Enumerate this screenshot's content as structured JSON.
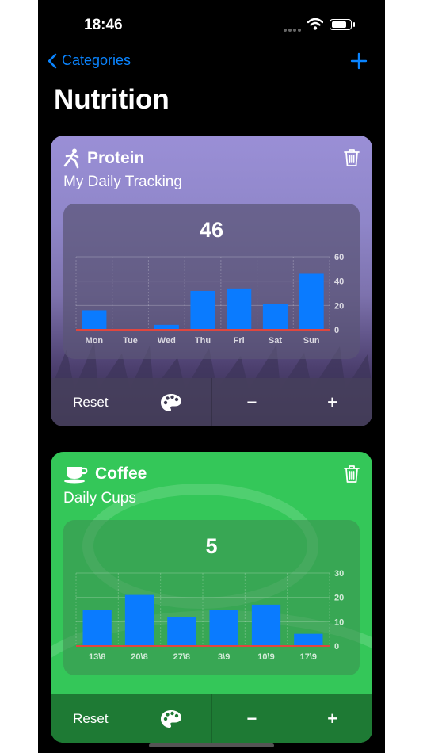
{
  "status_bar": {
    "time": "18:46"
  },
  "nav": {
    "back_label": "Categories",
    "back_icon": "chevron-left-icon",
    "add_icon": "plus-icon"
  },
  "page": {
    "title": "Nutrition"
  },
  "colors": {
    "accent": "#0a84ff",
    "bar": "#0a7bff",
    "baseline": "#e0463f",
    "coffee_card": "#34c759"
  },
  "cards": [
    {
      "name": "Protein",
      "subtitle": "My Daily Tracking",
      "icon": "running-figure-icon",
      "value": "46",
      "buttons": {
        "reset": "Reset",
        "palette_icon": "palette-icon",
        "minus": "−",
        "plus": "+"
      }
    },
    {
      "name": "Coffee",
      "subtitle": "Daily Cups",
      "icon": "coffee-cup-icon",
      "value": "5",
      "buttons": {
        "reset": "Reset",
        "palette_icon": "palette-icon",
        "minus": "−",
        "plus": "+"
      }
    }
  ],
  "chart_data": [
    {
      "type": "bar",
      "categories": [
        "Mon",
        "Tue",
        "Wed",
        "Thu",
        "Fri",
        "Sat",
        "Sun"
      ],
      "values": [
        16,
        0,
        4,
        32,
        34,
        21,
        46
      ],
      "ylim": [
        0,
        60
      ],
      "yticks": [
        0,
        20,
        40,
        60
      ],
      "grid": true,
      "y_axis_position": "right"
    },
    {
      "type": "bar",
      "categories": [
        "13\\8",
        "20\\8",
        "27\\8",
        "3\\9",
        "10\\9",
        "17\\9"
      ],
      "values": [
        15,
        21,
        12,
        15,
        17,
        5
      ],
      "ylim": [
        0,
        30
      ],
      "yticks": [
        0,
        10,
        20,
        30
      ],
      "grid": true,
      "y_axis_position": "right"
    }
  ]
}
